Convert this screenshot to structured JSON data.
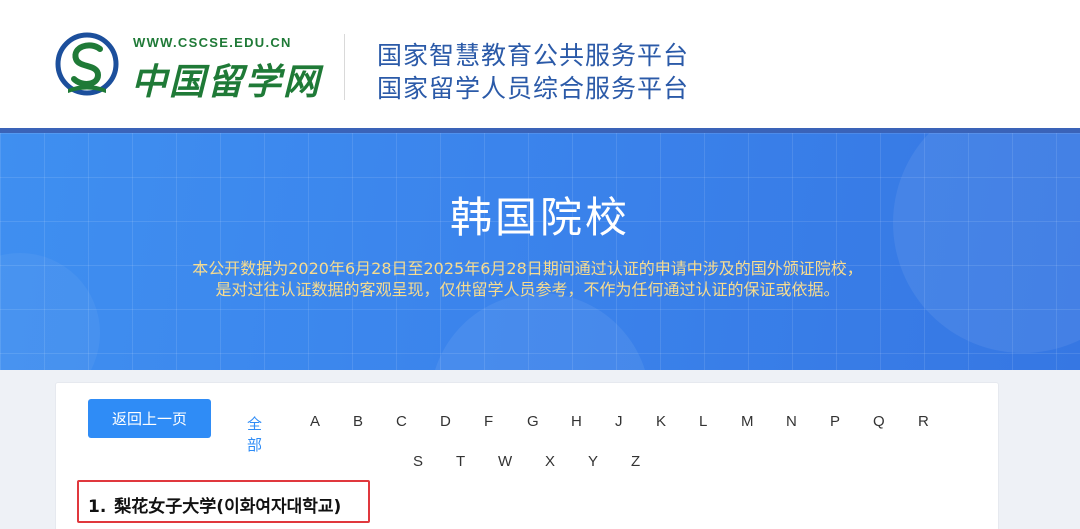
{
  "header": {
    "logo_url_text": "WWW.CSCSE.EDU.CN",
    "logo_name": "中国留学网",
    "platform_line_1": "国家智慧教育公共服务平台",
    "platform_line_2": "国家留学人员综合服务平台",
    "icons": [
      "logo-s-mark-icon"
    ]
  },
  "banner": {
    "title": "韩国院校",
    "note_line_1": "本公开数据为2020年6月28日至2025年6月28日期间通过认证的申请中涉及的国外颁证院校，",
    "note_line_2": "是对过往认证数据的客观呈现，仅供留学人员参考，不作为任何通过认证的保证或依据。",
    "note_color": "#f7dc8f"
  },
  "content": {
    "back_label": "返回上一页",
    "letters_row_1": [
      "全部",
      "A",
      "B",
      "C",
      "D",
      "F",
      "G",
      "H",
      "J",
      "K",
      "L",
      "M",
      "N",
      "P",
      "Q",
      "R"
    ],
    "letters_row_2": [
      "S",
      "T",
      "W",
      "X",
      "Y",
      "Z"
    ],
    "active_letter": "全部",
    "schools": [
      {
        "number": "1.",
        "name": "梨花女子大学(이화여자대학교)"
      }
    ],
    "highlight_color": "#e0383d"
  },
  "colors": {
    "accent": "#2f8cf6",
    "brand_green": "#1f7a37",
    "platform_blue": "#2b5aa8"
  }
}
